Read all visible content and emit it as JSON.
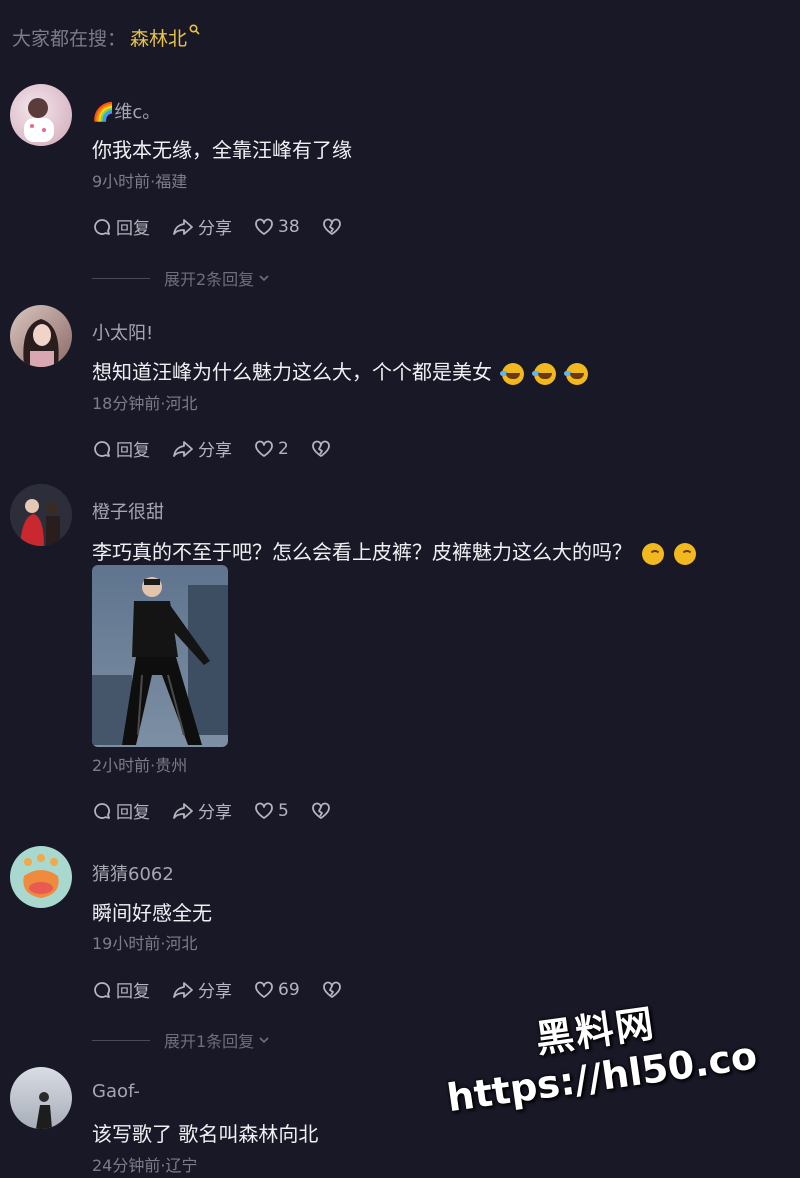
{
  "search_hint": {
    "prefix": "大家都在搜：",
    "keyword": "森林北"
  },
  "comments": [
    {
      "username": "🌈维c。",
      "text": "你我本无缘，全靠汪峰有了缘",
      "meta": "9小时前·福建",
      "reply_label": "回复",
      "share_label": "分享",
      "likes": "38",
      "expand_label": "展开2条回复"
    },
    {
      "username": "小太阳!",
      "text": "想知道汪峰为什么魅力这么大，个个都是美女",
      "meta": "18分钟前·河北",
      "reply_label": "回复",
      "share_label": "分享",
      "likes": "2"
    },
    {
      "username": "橙子很甜",
      "text": "李巧真的不至于吧？怎么会看上皮裤？皮裤魅力这么大的吗？",
      "meta": "2小时前·贵州",
      "reply_label": "回复",
      "share_label": "分享",
      "likes": "5"
    },
    {
      "username": "猜猜6062",
      "text": "瞬间好感全无",
      "meta": "19小时前·河北",
      "reply_label": "回复",
      "share_label": "分享",
      "likes": "69",
      "expand_label": "展开1条回复"
    },
    {
      "username": "Gaof-",
      "text": "该写歌了 歌名叫森林向北",
      "meta": "24分钟前·辽宁"
    }
  ],
  "watermark": {
    "line1": "黑料网",
    "line2": "https://hl50.co"
  }
}
